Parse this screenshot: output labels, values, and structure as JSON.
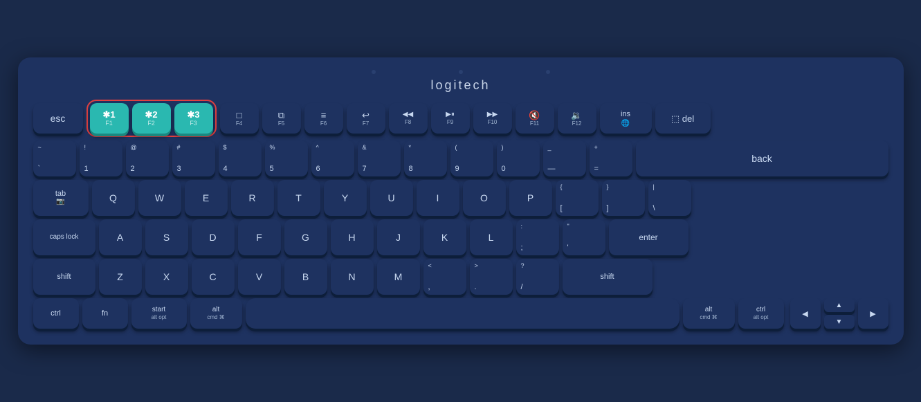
{
  "logo": "logitech",
  "keyboard": {
    "brand_color": "#1e3260",
    "accent_color": "#2ab8b0",
    "highlight_color": "#e04040",
    "rows": {
      "fn_row": {
        "keys": [
          {
            "id": "esc",
            "main": "esc",
            "sub": "",
            "type": "esc"
          },
          {
            "id": "bt1",
            "main": "✱1",
            "sub": "F1",
            "type": "bt"
          },
          {
            "id": "bt2",
            "main": "✱2",
            "sub": "F2",
            "type": "bt"
          },
          {
            "id": "bt3",
            "main": "✱3",
            "sub": "F3",
            "type": "bt"
          },
          {
            "id": "f4",
            "main": "□",
            "sub": "F4",
            "type": "fn"
          },
          {
            "id": "f5",
            "main": "⧉",
            "sub": "F5",
            "type": "fn"
          },
          {
            "id": "f6",
            "main": "≡",
            "sub": "F6",
            "type": "fn"
          },
          {
            "id": "f7",
            "main": "↵",
            "sub": "F7",
            "type": "fn"
          },
          {
            "id": "f8",
            "main": "◀◀",
            "sub": "F8",
            "type": "fn"
          },
          {
            "id": "f9",
            "main": "▶⏸",
            "sub": "F9",
            "type": "fn"
          },
          {
            "id": "f10",
            "main": "▶▶",
            "sub": "F10",
            "type": "fn"
          },
          {
            "id": "f11",
            "main": "🔇",
            "sub": "F11",
            "type": "fn"
          },
          {
            "id": "f12",
            "main": "🔉",
            "sub": "F12",
            "type": "fn"
          },
          {
            "id": "ins",
            "main": "ins",
            "sub": "🌐",
            "type": "fn"
          },
          {
            "id": "del",
            "main": "del",
            "sub": "",
            "type": "fn"
          }
        ]
      },
      "num_row": {
        "keys": [
          {
            "id": "tilde",
            "top": "~",
            "bottom": "`",
            "type": "num"
          },
          {
            "id": "1",
            "top": "!",
            "bottom": "1",
            "type": "num"
          },
          {
            "id": "2",
            "top": "@",
            "bottom": "2",
            "type": "num"
          },
          {
            "id": "3",
            "top": "#",
            "bottom": "3",
            "type": "num"
          },
          {
            "id": "4",
            "top": "$",
            "bottom": "4",
            "type": "num"
          },
          {
            "id": "5",
            "top": "%",
            "bottom": "5",
            "type": "num"
          },
          {
            "id": "6",
            "top": "^",
            "bottom": "6",
            "type": "num"
          },
          {
            "id": "7",
            "top": "&",
            "bottom": "7",
            "type": "num"
          },
          {
            "id": "8",
            "top": "*",
            "bottom": "8",
            "type": "num"
          },
          {
            "id": "9",
            "top": "(",
            "bottom": "9",
            "type": "num"
          },
          {
            "id": "0",
            "top": ")",
            "bottom": "0",
            "type": "num"
          },
          {
            "id": "minus",
            "top": "_",
            "bottom": "—",
            "type": "num"
          },
          {
            "id": "equals",
            "top": "+",
            "bottom": "=",
            "type": "num"
          },
          {
            "id": "back",
            "main": "back",
            "type": "wide"
          }
        ]
      },
      "qwerty_row": {
        "keys": [
          "Q",
          "W",
          "E",
          "R",
          "T",
          "Y",
          "U",
          "I",
          "O",
          "P"
        ],
        "specials": {
          "left": {
            "id": "tab",
            "main": "tab",
            "sub": "📷",
            "type": "tab"
          },
          "right1": {
            "top": "{",
            "bottom": "["
          },
          "right2": {
            "top": "}",
            "bottom": "]"
          },
          "right3": {
            "top": "|",
            "bottom": "\\"
          }
        }
      },
      "asdf_row": {
        "keys": [
          "A",
          "S",
          "D",
          "F",
          "G",
          "H",
          "J",
          "K",
          "L"
        ],
        "specials": {
          "left": {
            "id": "caps",
            "main": "caps lock"
          },
          "right1": {
            "top": ":",
            "bottom": ";"
          },
          "right2": {
            "top": "\"",
            "bottom": "'"
          },
          "right3": {
            "id": "enter",
            "main": "enter"
          }
        }
      },
      "zxcv_row": {
        "keys": [
          "Z",
          "X",
          "C",
          "V",
          "B",
          "N",
          "M"
        ],
        "specials": {
          "left": {
            "id": "shift-l",
            "main": "shift"
          },
          "right1": {
            "top": "<",
            "bottom": ","
          },
          "right2": {
            "top": ">",
            "bottom": "."
          },
          "right3": {
            "top": "?",
            "bottom": "/"
          },
          "right4": {
            "id": "shift-r",
            "main": "shift"
          }
        }
      },
      "bottom_row": {
        "keys": [
          {
            "id": "ctrl-l",
            "main": "ctrl",
            "type": "mod"
          },
          {
            "id": "fn-l",
            "main": "fn",
            "type": "mod"
          },
          {
            "id": "start",
            "main": "start",
            "sub": "alt opt",
            "type": "mod"
          },
          {
            "id": "alt-l",
            "main": "alt",
            "sub": "cmd ⌘",
            "type": "mod"
          },
          {
            "id": "space",
            "type": "space"
          },
          {
            "id": "alt-r",
            "main": "alt",
            "sub": "cmd ⌘",
            "type": "mod"
          },
          {
            "id": "ctrl-r",
            "main": "ctrl",
            "sub": "alt opt",
            "type": "mod"
          }
        ]
      }
    }
  }
}
